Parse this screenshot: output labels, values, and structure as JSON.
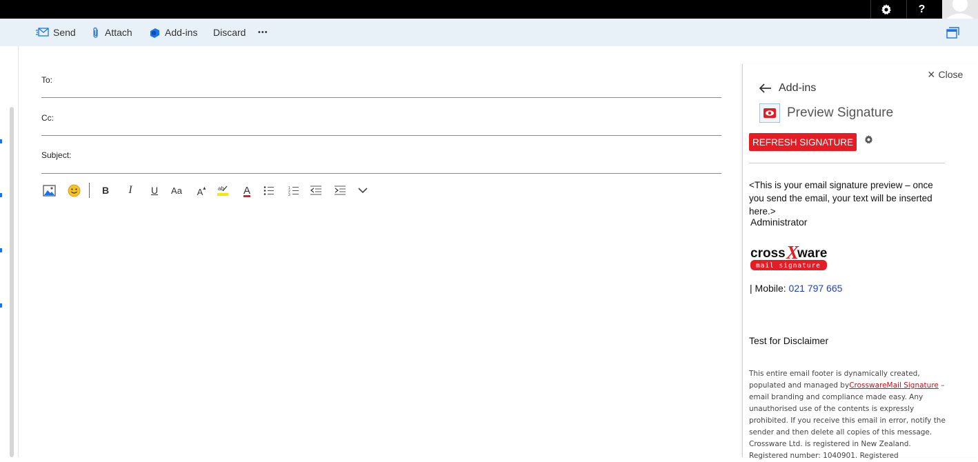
{
  "topbar": {
    "gear_icon": "gear-icon",
    "help_label": "?"
  },
  "toolbar": {
    "send": "Send",
    "attach": "Attach",
    "addins": "Add-ins",
    "discard": "Discard",
    "more": "•••"
  },
  "compose": {
    "to_label": "To:",
    "cc_label": "Cc:",
    "subject_label": "Subject:",
    "format_tools": [
      "insert-picture",
      "emoji",
      "bold",
      "italic",
      "underline",
      "font-size",
      "grow-font",
      "highlight",
      "font-color",
      "bullets",
      "numbering",
      "decrease-indent",
      "increase-indent",
      "more-options"
    ],
    "bold": "B",
    "italic": "I",
    "underline": "U",
    "font_size": "Aa",
    "grow_font": "A",
    "font_color": "A"
  },
  "pane": {
    "close_label": "Close",
    "back_label": "Add-ins",
    "title": "Preview Signature",
    "refresh_button": "REFRESH SIGNATURE",
    "preview_text": "<This is your email signature preview – once you send the email, your text will be inserted here.>",
    "name": "Administrator",
    "logo_word_1": "cross",
    "logo_word_x": "X",
    "logo_word_2": "ware",
    "logo_sub": "mail signature",
    "mobile_label": "| Mobile: ",
    "mobile_number": "021 797 665",
    "disclaimer_title": "Test for Disclaimer",
    "disclaimer_before": "This entire email footer is dynamically created, populated and managed by",
    "disclaimer_link": "CrosswareMail Signature",
    "disclaimer_after": " – email branding and compliance made easy. Any unauthorised use of the contents is expressly prohibited.  If you receive this email in error, notify the sender and then delete all copies of this message. Crossware Ltd. is registered in New Zealand. Registered number: 1040901. Registered"
  },
  "colors": {
    "accent": "#e61c24",
    "link_blue": "#1a3fc8",
    "command_bar_bg": "#e9f1f8"
  }
}
